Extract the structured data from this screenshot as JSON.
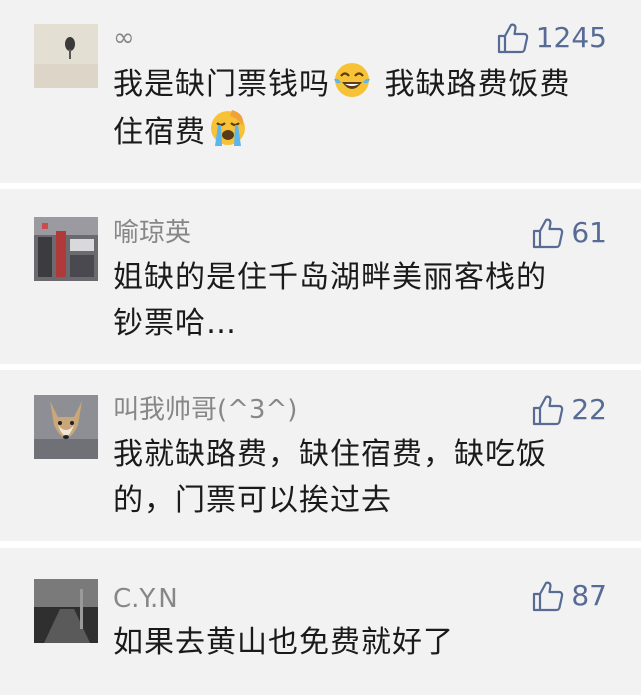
{
  "comments": [
    {
      "name": "∞",
      "likes": "1245",
      "lines": [
        {
          "before": "我是缺门票钱吗",
          "emoji": "tears-of-joy-emoji",
          "after": " 我缺路费饭费"
        },
        {
          "before": "住宿费",
          "emoji": "loudly-crying-emoji",
          "after": ""
        }
      ]
    },
    {
      "name": "喻琼英",
      "likes": "61",
      "lines": [
        {
          "text": "姐缺的是住千岛湖畔美丽客栈的"
        },
        {
          "text": "钞票哈…"
        }
      ]
    },
    {
      "name": "叫我帅哥(^3^)",
      "likes": "22",
      "lines": [
        {
          "text": "我就缺路费，缺住宿费，缺吃饭"
        },
        {
          "text": "的，门票可以挨过去"
        }
      ]
    },
    {
      "name": "C.Y.N",
      "likes": "87",
      "lines": [
        {
          "text": "如果去黄山也免费就好了"
        }
      ]
    }
  ],
  "colors": {
    "background": "#f2f2f2",
    "separator": "#ffffff",
    "name": "#878787",
    "like": "#576b95",
    "text": "#1a1a1a"
  },
  "icons": {
    "like": "thumbs-up-icon"
  }
}
